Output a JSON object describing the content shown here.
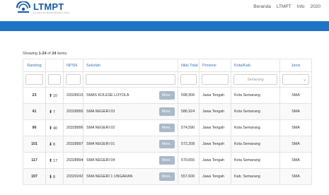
{
  "header": {
    "logo_text": "LTMPT",
    "logo_sub": "Lembaga Tes Masuk Perguruan Tinggi",
    "nav": [
      "Beranda",
      "LTMPT",
      "Info",
      "2020"
    ]
  },
  "summary": {
    "prefix": "Showing ",
    "range": "1-24",
    "mid": " of ",
    "total": "24",
    "suffix": " items."
  },
  "table": {
    "columns": [
      "Ranking",
      "",
      "NPSN",
      "Sekolah",
      "Nilai Total",
      "Provinsi",
      "Kota/Kab.",
      "Jenis"
    ],
    "filter_select_value": "Semarang",
    "more_label": "More..",
    "rows": [
      {
        "rank": "23",
        "dir": "up",
        "delta": "10",
        "npsn": "20328915",
        "sekolah": "SMAS KOLESE LOYOLA",
        "nilai": "598,906",
        "provinsi": "Jawa Tengah",
        "kota": "Kota Semarang",
        "jenis": "SMA"
      },
      {
        "rank": "41",
        "dir": "down",
        "delta": "7",
        "npsn": "20328895",
        "sekolah": "SMA NEGERI 03",
        "nilai": "586,924",
        "provinsi": "Jawa Tengah",
        "kota": "Kota Semarang",
        "jenis": "SMA"
      },
      {
        "rank": "96",
        "dir": "up",
        "delta": "40",
        "npsn": "20328896",
        "sekolah": "SMA NEGERI 02",
        "nilai": "574,590",
        "provinsi": "Jawa Tengah",
        "kota": "Kota Semarang",
        "jenis": "SMA"
      },
      {
        "rank": "101",
        "dir": "down",
        "delta": "8",
        "npsn": "20328897",
        "sekolah": "SMA NEGERI 01",
        "nilai": "572,208",
        "provinsi": "Jawa Tengah",
        "kota": "Kota Semarang",
        "jenis": "SMA"
      },
      {
        "rank": "117",
        "dir": "up",
        "delta": "17",
        "npsn": "20328894",
        "sekolah": "SMA NEGERI 04",
        "nilai": "570,656",
        "provinsi": "Jawa Tengah",
        "kota": "Kota Semarang",
        "jenis": "SMA"
      },
      {
        "rank": "197",
        "dir": "down",
        "delta": "8",
        "npsn": "20320242",
        "sekolah": "SMA NEGERI 1 UNGARAN",
        "nilai": "557,600",
        "provinsi": "Jawa Tengah",
        "kota": "Kab. Semarang",
        "jenis": "SMA"
      }
    ]
  },
  "colors": {
    "brand": "#1e74c5",
    "up": "#2c9b2c",
    "down": "#d43030"
  }
}
